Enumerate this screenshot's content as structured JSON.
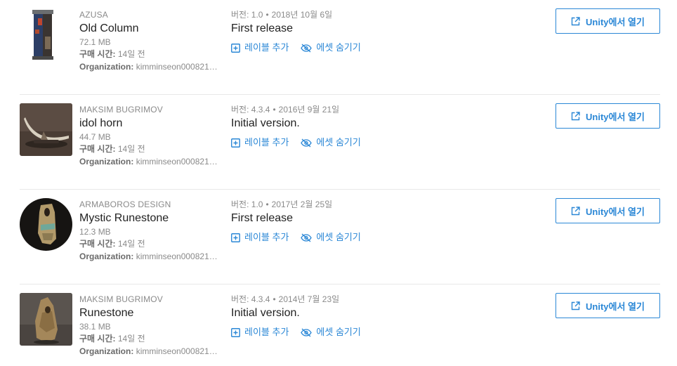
{
  "labels": {
    "version_prefix": "버전:",
    "purchased_prefix": "구매 시간:",
    "org_prefix": "Organization:",
    "add_label": "레이블 추가",
    "hide_asset": "에셋 숨기기",
    "open_in_unity": "Unity에서 열기"
  },
  "assets": [
    {
      "publisher": "AZUSA",
      "title": "Old Column",
      "size": "72.1 MB",
      "purchased": "14일 전",
      "organization": "kimminseon000821…",
      "version": "1.0",
      "date": "2018년 10월 6일",
      "notes": "First release",
      "thumb_icon": "column-thumbnail"
    },
    {
      "publisher": "MAKSIM BUGRIMOV",
      "title": "idol horn",
      "size": "44.7 MB",
      "purchased": "14일 전",
      "organization": "kimminseon000821…",
      "version": "4.3.4",
      "date": "2016년 9월 21일",
      "notes": "Initial version.",
      "thumb_icon": "horn-thumbnail"
    },
    {
      "publisher": "ARMABOROS DESIGN",
      "title": "Mystic Runestone",
      "size": "12.3 MB",
      "purchased": "14일 전",
      "organization": "kimminseon000821…",
      "version": "1.0",
      "date": "2017년 2월 25일",
      "notes": "First release",
      "thumb_icon": "mystic-runestone-thumbnail"
    },
    {
      "publisher": "MAKSIM BUGRIMOV",
      "title": "Runestone",
      "size": "38.1 MB",
      "purchased": "14일 전",
      "organization": "kimminseon000821…",
      "version": "4.3.4",
      "date": "2014년 7월 23일",
      "notes": "Initial version.",
      "thumb_icon": "runestone-thumbnail"
    }
  ],
  "colors": {
    "accent": "#2a87d6",
    "muted": "#8a8a8a",
    "divider": "#e8e8e8"
  }
}
